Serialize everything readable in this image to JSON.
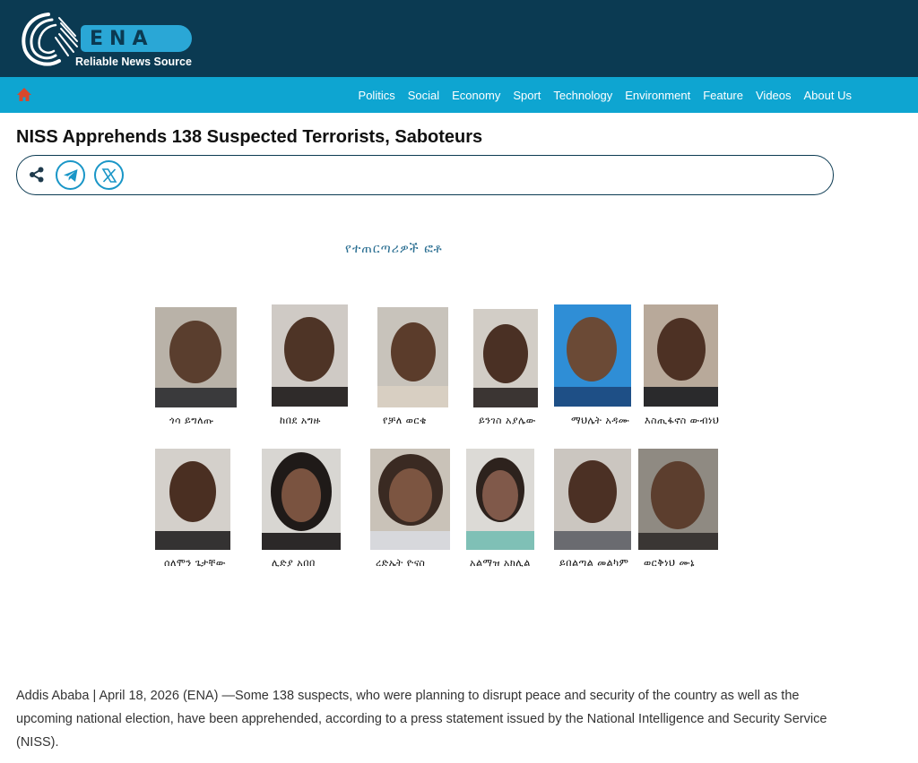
{
  "header": {
    "logo_text": "ENA",
    "tagline": "Reliable News Source",
    "colors": {
      "header_bg": "#0b3a52",
      "nav_bg": "#0ea5d1",
      "accent": "#2aa7d6"
    }
  },
  "nav": {
    "home_icon": "home-icon",
    "items": [
      {
        "label": "Politics"
      },
      {
        "label": "Social"
      },
      {
        "label": "Economy"
      },
      {
        "label": "Sport"
      },
      {
        "label": "Technology"
      },
      {
        "label": "Environment"
      },
      {
        "label": "Feature"
      },
      {
        "label": "Videos"
      },
      {
        "label": "About Us"
      }
    ]
  },
  "article": {
    "title": "NISS Apprehends 138 Suspected Terrorists, Saboteurs",
    "share_icons": [
      "share-icon",
      "telegram-icon",
      "x-icon"
    ],
    "figure_caption": "የተጠርጣሪዎች ፎቶ",
    "suspects_row1": [
      {
        "name": "ጎሳ ይግለጡ"
      },
      {
        "name": "ከበደ አግዙ"
      },
      {
        "name": "የቻለ ወርቄ"
      },
      {
        "name": "ይንገስ አያሌው"
      },
      {
        "name": "ማህሌት አዳሙ"
      },
      {
        "name": "እስጢፋኖስ ውብነህ"
      }
    ],
    "suspects_row2": [
      {
        "name": "ሰለሞን ጌታቸው"
      },
      {
        "name": "ሊድያ አበበ"
      },
      {
        "name": "ረድኤት ዮናስ"
      },
      {
        "name": "አልማዝ አክሊል"
      },
      {
        "name": "ይበልጣል መልካም"
      },
      {
        "name": "ወርቅነህ ሙኔ"
      }
    ],
    "body": "Addis Ababa | April 18, 2026 (ENA) —Some 138 suspects, who were planning to disrupt peace and security of the country as well as the upcoming national election, have been apprehended, according to a press statement issued by the National Intelligence and Security Service (NISS)."
  }
}
